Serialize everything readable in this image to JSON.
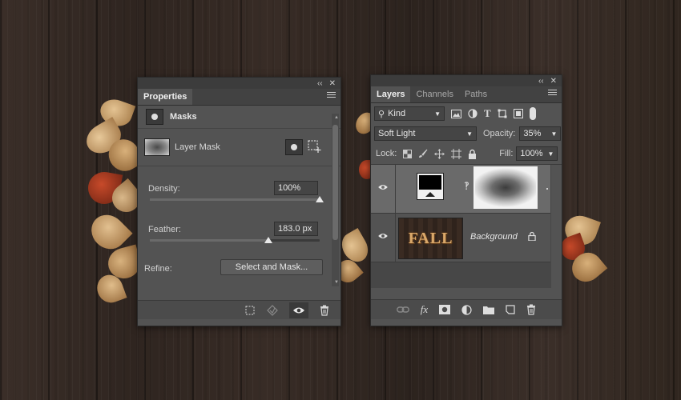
{
  "properties": {
    "tab_title": "Properties",
    "section_title": "Masks",
    "mask_label": "Layer Mask",
    "density_label": "Density:",
    "density_value": "100%",
    "density_level": 1.0,
    "feather_label": "Feather:",
    "feather_value": "183.0 px",
    "feather_level": 0.7,
    "refine_label": "Refine:",
    "select_mask_label": "Select and Mask..."
  },
  "layers": {
    "tabs": [
      {
        "label": "Layers",
        "active": true
      },
      {
        "label": "Channels",
        "active": false
      },
      {
        "label": "Paths",
        "active": false
      }
    ],
    "filter_kind": "Kind",
    "blend_mode": "Soft Light",
    "opacity_label": "Opacity:",
    "opacity_value": "35%",
    "lock_label": "Lock:",
    "fill_label": "Fill:",
    "fill_value": "100%",
    "rows": [
      {
        "name": "",
        "type": "adjustment-with-mask"
      },
      {
        "name": "Background",
        "type": "background",
        "thumb_text": "FALL"
      }
    ]
  },
  "colors": {
    "panel_bg": "#535353",
    "panel_dark": "#424242",
    "selected_row": "#696969",
    "leaf_gold": "#c9a06a",
    "leaf_red": "#9a3a22"
  }
}
